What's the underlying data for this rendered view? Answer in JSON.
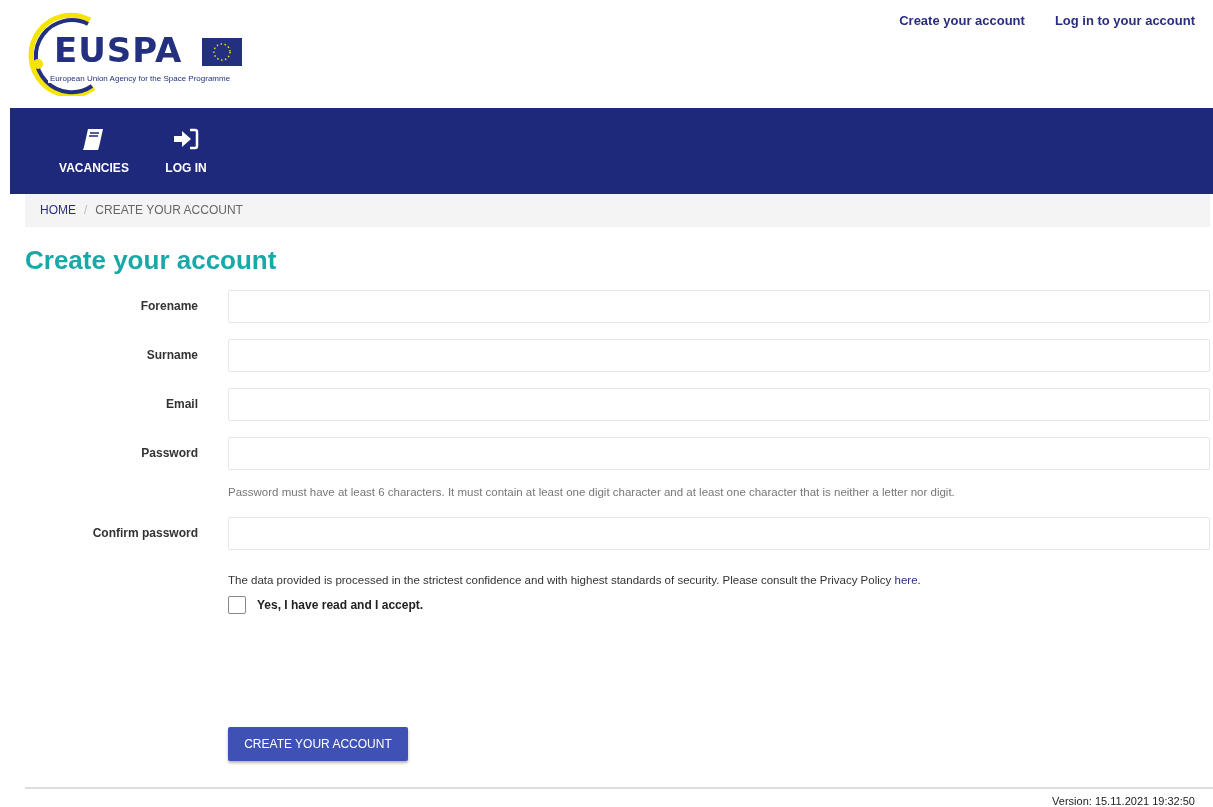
{
  "logo": {
    "wordmark": "EUSPA",
    "tagline": "European Union Agency for the Space Programme"
  },
  "top_links": [
    "Create your account",
    "Log in to your account"
  ],
  "nav": [
    {
      "kind": "book",
      "label": "VACANCIES"
    },
    {
      "kind": "login",
      "label": "LOG IN"
    }
  ],
  "breadcrumb": {
    "items": [
      "HOME"
    ],
    "separator": "/",
    "current": "CREATE YOUR ACCOUNT"
  },
  "title": "Create your account",
  "fields": [
    {
      "label": "Forename"
    },
    {
      "label": "Surname"
    },
    {
      "label": "Email"
    },
    {
      "label": "Password",
      "hint": "Password must have at least 6 characters. It must contain at least one digit character and at least one character that is neither a letter nor digit."
    },
    {
      "label": "Confirm password"
    }
  ],
  "privacy": {
    "text": "The data provided is processed in the strictest confidence and with highest standards of security. Please consult the Privacy Policy",
    "link": "here",
    "end": "."
  },
  "accept": {
    "label": "Yes, I have read and I accept.",
    "checked": false
  },
  "submit": "CREATE YOUR ACCOUNT",
  "version": "Version: 15.11.2021 19:32:50"
}
